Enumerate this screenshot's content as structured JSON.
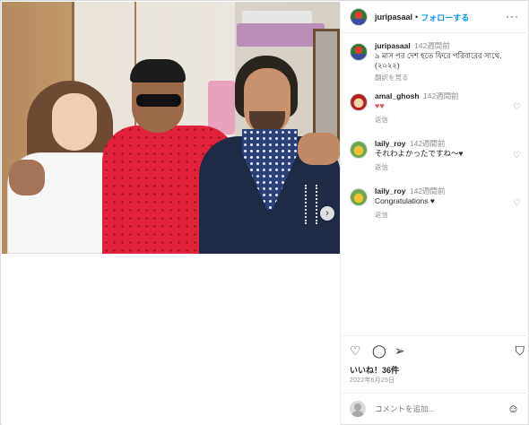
{
  "header": {
    "username": "juripasaal",
    "separator": "•",
    "follow_label": "フォローする",
    "more_label": "···"
  },
  "photo": {
    "next_label": "›"
  },
  "caption": {
    "username": "juripasaal",
    "time": "142週間前",
    "text": "৯ মাস পর দেশ হতে ফিরে পরিবারের সাথে. (২০২২)",
    "translate_label": "翻訳を見る"
  },
  "comments": [
    {
      "username": "amal_ghosh",
      "time": "142週間前",
      "text": "♥♥",
      "reply_label": "返信"
    },
    {
      "username": "laily_roy",
      "time": "142週間前",
      "text": "それわよかったですね～♥",
      "reply_label": "返信"
    },
    {
      "username": "laily_roy",
      "time": "142週間前",
      "text": "Congratulations ♥",
      "reply_label": "返信"
    }
  ],
  "actions": {
    "like_icon": "♡",
    "comment_icon": "◯",
    "share_icon": "➢",
    "save_icon": "⛉",
    "likes_text": "いいね！36件",
    "date_text": "2022年6月25日"
  },
  "add_comment": {
    "placeholder": "コメントを追加...",
    "emoji_icon": "☺"
  },
  "colors": {
    "accent": "#0095f6",
    "heart": "#ed4956",
    "text": "#262626",
    "muted": "#8e8e8e"
  }
}
